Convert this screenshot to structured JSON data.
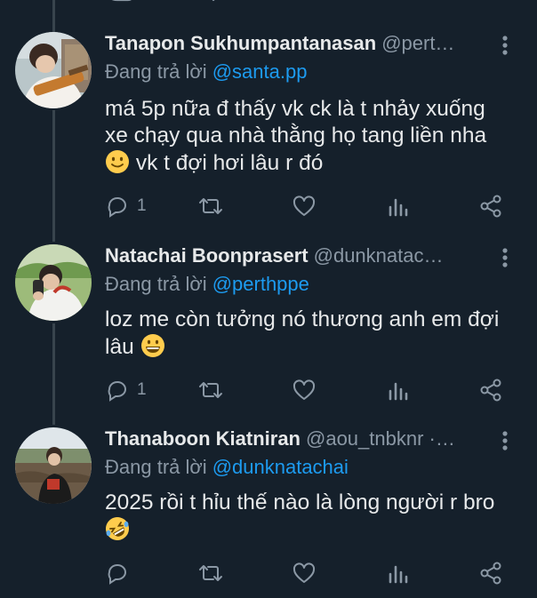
{
  "tweets": [
    {
      "name": "Tanapon Sukhumpantanasan",
      "handle": "@pert…",
      "reply_prefix": "Đang trả lời",
      "reply_to": "@santa.pp",
      "lines": [
        "má 5p nữa đ thấy vk ck là t nhảy xuống",
        "xe chạy qua nhà thằng họ tang liền nha"
      ],
      "line3_text": "vk t đợi hơi lâu r đó",
      "line3_emoji": "slightly-smiling-face-emoji",
      "reply_count": "1"
    },
    {
      "name": "Natachai Boonprasert",
      "handle": "@dunknatac…",
      "reply_prefix": "Đang trả lời",
      "reply_to": "@perthppe",
      "line1": "loz me còn tưởng nó thương anh em đợi",
      "line2_text": "lâu",
      "line2_emoji": "grinning-face-emoji",
      "reply_count": "1"
    },
    {
      "name": "Thanaboon Kiatniran",
      "handle": "@aou_tnbknr ·…",
      "reply_prefix": "Đang trả lời",
      "reply_to": "@dunknatachai",
      "line1": "2025 rồi t hỉu thế nào là lòng người r bro",
      "line2_emoji": "rolling-on-floor-laughing-emoji",
      "reply_count": ""
    }
  ],
  "colors": {
    "background": "#15202b",
    "name": "#e7e9ea",
    "secondary": "#8b98a5",
    "mention": "#1d9bf0",
    "thread_line": "#38444d"
  }
}
